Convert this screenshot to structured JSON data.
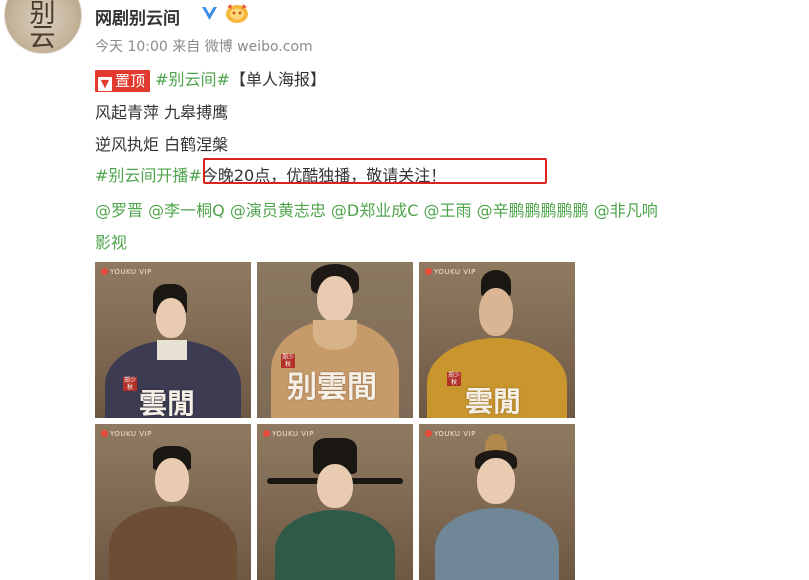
{
  "post": {
    "username": "网剧别云间",
    "time": "今天 10:00",
    "source_prefix": "来自",
    "source": "微博 weibo.com",
    "pin_label": "置顶",
    "line1_tag": "#别云间#",
    "line1_text": "【单人海报】",
    "line2": "风起青萍  九皋搏鹰",
    "line3": "逆风执炬  白鹤涅槃",
    "line4_tag": "#别云间开播#",
    "line4_text": "今晚20点，优酷独播，敬请关注！",
    "mentions": [
      "@罗晋",
      "@李一桐Q",
      "@演员黄志忠",
      "@D郑业成C",
      "@王雨",
      "@辛鹏鹏鹏鹏鹏",
      "@非凡响"
    ],
    "mention_continued": "影视"
  },
  "avatar_glyph": "别云",
  "posters": [
    {
      "logo": "YOUKU VIP",
      "title": "雲閒"
    },
    {
      "logo": "",
      "title": "别雲間"
    },
    {
      "logo": "YOUKU VIP",
      "title": "雲閒"
    },
    {
      "logo": "YOUKU VIP",
      "title": ""
    },
    {
      "logo": "YOUKU VIP",
      "title": ""
    },
    {
      "logo": "YOUKU VIP",
      "title": ""
    }
  ],
  "colors": {
    "accent_green": "#4fa44c",
    "highlight_red": "#d9241d",
    "pin_red": "#e23a2e",
    "meta_gray": "#8a8a8a"
  }
}
